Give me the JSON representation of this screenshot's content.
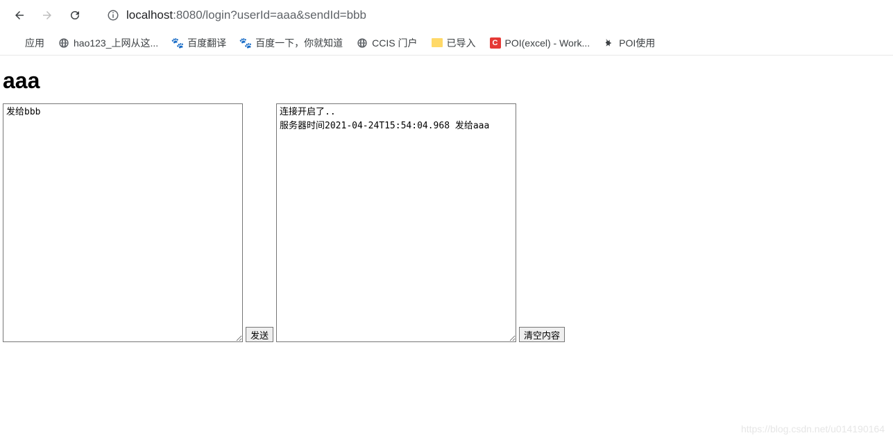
{
  "browser": {
    "url_host": "localhost",
    "url_path": ":8080/login?userId=aaa&sendId=bbb"
  },
  "bookmarks": {
    "apps": "应用",
    "hao123": "hao123_上网从这...",
    "baidu_translate": "百度翻译",
    "baidu_search": "百度一下，你就知道",
    "ccis": "CCIS 门户",
    "imported": "已导入",
    "poi": "POI(excel) - Work...",
    "poi_use": "POI使用"
  },
  "page": {
    "title": "aaa",
    "input_value": "发给bbb",
    "log_value": "连接开启了..\n服务器时间2021-04-24T15:54:04.968 发给aaa",
    "send_button": "发送",
    "clear_button": "清空内容"
  },
  "watermark": "https://blog.csdn.net/u014190164"
}
